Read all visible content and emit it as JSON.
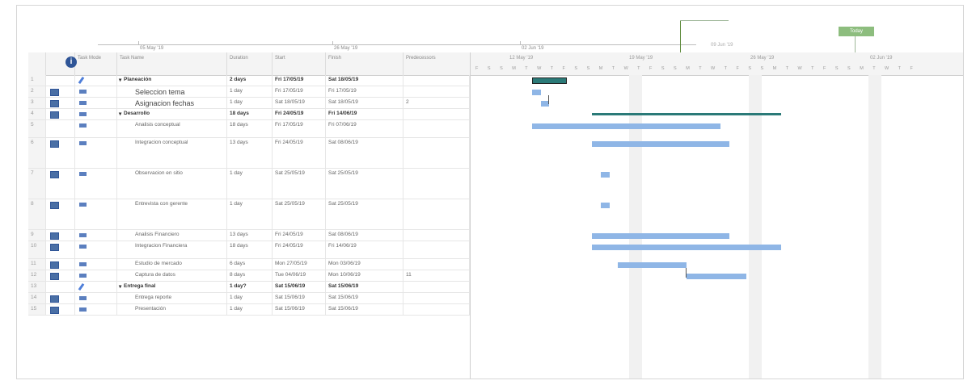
{
  "timeline": {
    "labels": [
      "05 May '19",
      "26 May '19",
      "02 Jun '19",
      "09 Jun '19"
    ],
    "today_label": "Today"
  },
  "columns": {
    "task_mode": "Task Mode",
    "task_name": "Task Name",
    "duration": "Duration",
    "start": "Start",
    "finish": "Finish",
    "predecessors": "Predecessors"
  },
  "gantt_header": {
    "weeks": [
      "12 May '19",
      "19 May '19",
      "26 May '19",
      "02 Jun '19"
    ],
    "days": "F S S M T W T F S S M T W T F S S M T W T F S S M T W T F S S M T W T F"
  },
  "tasks": [
    {
      "id": "1",
      "name": "Planeación",
      "duration": "2 days",
      "start": "Fri 17/05/19",
      "finish": "Sat 18/05/19",
      "pred": "",
      "summary": true,
      "indicator": false,
      "mode": "auto"
    },
    {
      "id": "2",
      "name": "Seleccion tema",
      "duration": "1 day",
      "start": "Fri 17/05/19",
      "finish": "Fri 17/05/19",
      "pred": "",
      "summary": false,
      "indicator": true,
      "mode": "task",
      "big": true
    },
    {
      "id": "3",
      "name": "Asignacion fechas",
      "duration": "1 day",
      "start": "Sat 18/05/19",
      "finish": "Sat 18/05/19",
      "pred": "2",
      "summary": false,
      "indicator": true,
      "mode": "task",
      "big": true
    },
    {
      "id": "4",
      "name": "Desarrollo",
      "duration": "18 days",
      "start": "Fri 24/05/19",
      "finish": "Fri 14/06/19",
      "pred": "",
      "summary": true,
      "indicator": true,
      "mode": "task"
    },
    {
      "id": "5",
      "name": "Analisis conceptual",
      "duration": "18 days",
      "start": "Fri 17/05/19",
      "finish": "Fri 07/06/19",
      "pred": "",
      "summary": false,
      "indicator": false,
      "mode": "task"
    },
    {
      "id": "6",
      "name": "Integracion conceptual",
      "duration": "13 days",
      "start": "Fri 24/05/19",
      "finish": "Sat 08/06/19",
      "pred": "",
      "summary": false,
      "indicator": true,
      "mode": "task"
    },
    {
      "id": "7",
      "name": "Observacion en sitio",
      "duration": "1 day",
      "start": "Sat 25/05/19",
      "finish": "Sat 25/05/19",
      "pred": "",
      "summary": false,
      "indicator": true,
      "mode": "task"
    },
    {
      "id": "8",
      "name": "Entrevista con gerente",
      "duration": "1 day",
      "start": "Sat 25/05/19",
      "finish": "Sat 25/05/19",
      "pred": "",
      "summary": false,
      "indicator": true,
      "mode": "task"
    },
    {
      "id": "9",
      "name": "Analisis Financiero",
      "duration": "13 days",
      "start": "Fri 24/05/19",
      "finish": "Sat 08/06/19",
      "pred": "",
      "summary": false,
      "indicator": true,
      "mode": "task"
    },
    {
      "id": "10",
      "name": "Integracion Financiera",
      "duration": "18 days",
      "start": "Fri 24/05/19",
      "finish": "Fri 14/06/19",
      "pred": "",
      "summary": false,
      "indicator": true,
      "mode": "task"
    },
    {
      "id": "11",
      "name": "Estudio de mercado",
      "duration": "6 days",
      "start": "Mon 27/05/19",
      "finish": "Mon 03/06/19",
      "pred": "",
      "summary": false,
      "indicator": true,
      "mode": "task"
    },
    {
      "id": "12",
      "name": "Captura de datos",
      "duration": "8 days",
      "start": "Tue 04/06/19",
      "finish": "Mon 10/06/19",
      "pred": "11",
      "summary": false,
      "indicator": true,
      "mode": "task"
    },
    {
      "id": "13",
      "name": "Entrega final",
      "duration": "1 day?",
      "start": "Sat 15/06/19",
      "finish": "Sat 15/06/19",
      "pred": "",
      "summary": true,
      "indicator": false,
      "mode": "auto"
    },
    {
      "id": "14",
      "name": "Entrega reporte",
      "duration": "1 day",
      "start": "Sat 15/06/19",
      "finish": "Sat 15/06/19",
      "pred": "",
      "summary": false,
      "indicator": true,
      "mode": "task"
    },
    {
      "id": "15",
      "name": "Presentación",
      "duration": "1 day",
      "start": "Sat 15/06/19",
      "finish": "Sat 15/06/19",
      "pred": "",
      "summary": false,
      "indicator": true,
      "mode": "task"
    }
  ]
}
